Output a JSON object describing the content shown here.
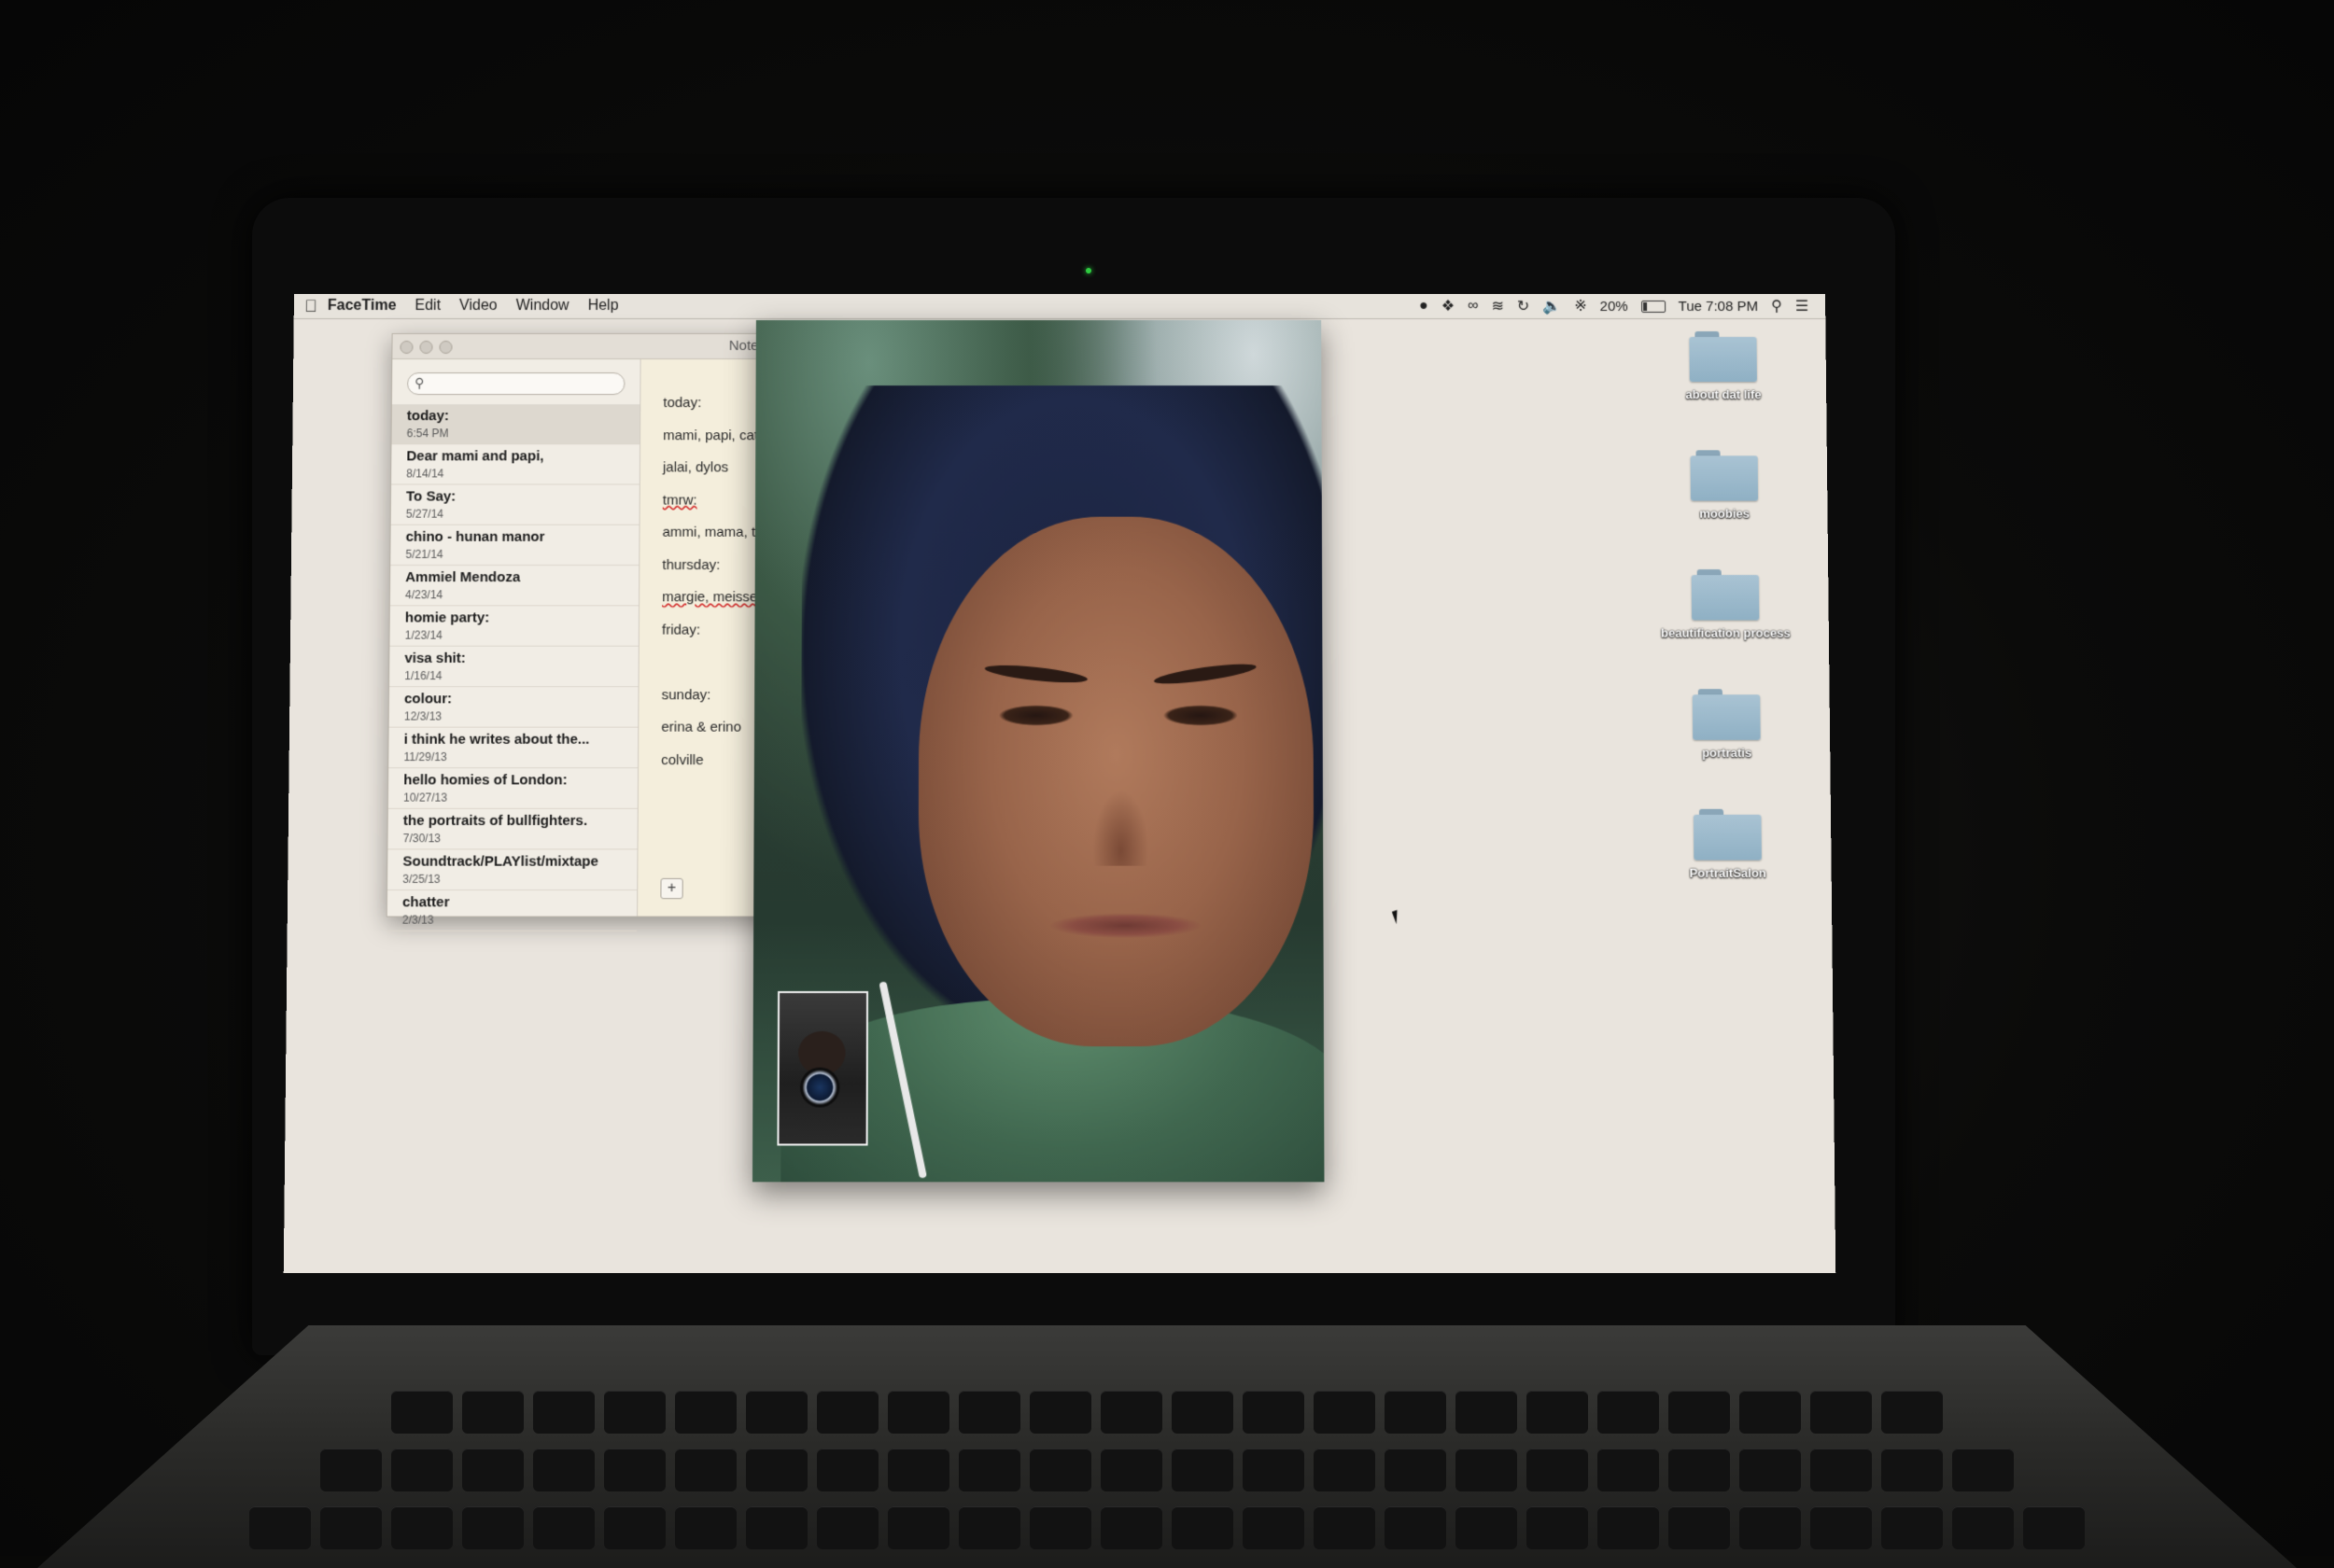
{
  "menubar": {
    "app_name": "FaceTime",
    "menus": [
      "Edit",
      "Video",
      "Window",
      "Help"
    ],
    "status": {
      "battery": "20%",
      "clock": "Tue 7:08 PM"
    }
  },
  "notes_window": {
    "title": "Notes",
    "search_placeholder": "",
    "notes": [
      {
        "title": "today:",
        "date": "6:54 PM"
      },
      {
        "title": "Dear mami and papi,",
        "date": "8/14/14"
      },
      {
        "title": "To Say:",
        "date": "5/27/14"
      },
      {
        "title": "chino - hunan manor",
        "date": "5/21/14"
      },
      {
        "title": "Ammiel Mendoza",
        "date": "4/23/14"
      },
      {
        "title": "homie party:",
        "date": "1/23/14"
      },
      {
        "title": "visa shit:",
        "date": "1/16/14"
      },
      {
        "title": "colour:",
        "date": "12/3/13"
      },
      {
        "title": "i think he writes about the...",
        "date": "11/29/13"
      },
      {
        "title": "hello homies of London:",
        "date": "10/27/13"
      },
      {
        "title": "the portraits of bullfighters.",
        "date": "7/30/13"
      },
      {
        "title": "Soundtrack/PLAYlist/mixtape",
        "date": "3/25/13"
      },
      {
        "title": "chatter",
        "date": "2/3/13"
      }
    ],
    "editor_lines": [
      "today:",
      "mami, papi, cate",
      "jalai, dylos",
      "tmrw:",
      "ammi, mama, tia",
      "thursday:",
      "margie, meisse",
      "friday:",
      "",
      "sunday:",
      "erina & erino",
      "colville"
    ],
    "add_button": "+"
  },
  "desktop": {
    "folders": [
      {
        "label": "about dat life"
      },
      {
        "label": "moobies"
      },
      {
        "label": "beautification process"
      },
      {
        "label": "portratis"
      },
      {
        "label": "PortraitSalon"
      }
    ]
  },
  "icons": {
    "apple": "apple-logo-icon",
    "search": "magnifier-icon",
    "wifi": "wifi-icon",
    "volume": "speaker-icon",
    "bluetooth": "bluetooth-icon",
    "battery": "battery-icon",
    "spotlight": "spotlight-icon",
    "notification_center": "list-icon"
  }
}
